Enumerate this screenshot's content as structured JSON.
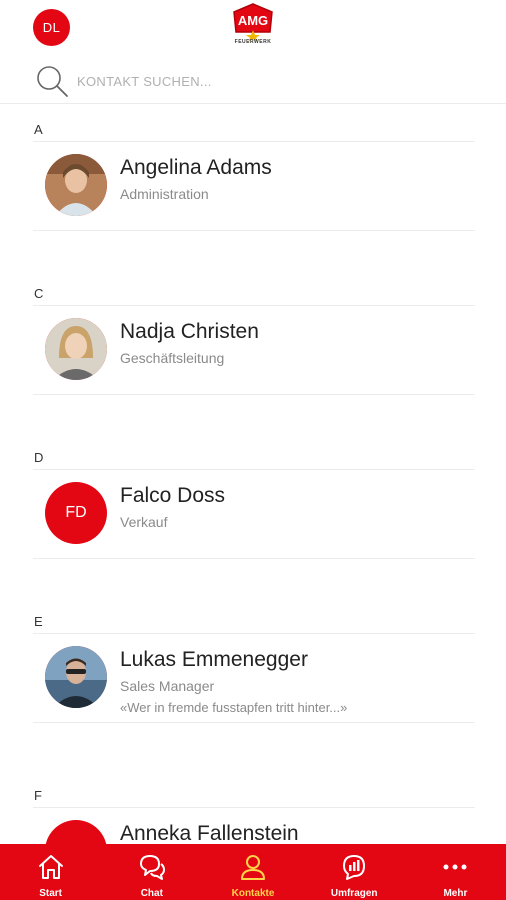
{
  "header": {
    "user_initials": "DL",
    "logo_text": "AMG",
    "logo_subtitle": "FEUERWERK"
  },
  "search": {
    "placeholder": "KONTAKT SUCHEN..."
  },
  "sections": [
    {
      "letter": "A",
      "contacts": [
        {
          "name": "Angelina Adams",
          "role": "Administration",
          "status": "",
          "initials": ""
        }
      ]
    },
    {
      "letter": "C",
      "contacts": [
        {
          "name": "Nadja Christen",
          "role": "Geschäftsleitung",
          "status": "",
          "initials": ""
        }
      ]
    },
    {
      "letter": "D",
      "contacts": [
        {
          "name": "Falco Doss",
          "role": "Verkauf",
          "status": "",
          "initials": "FD"
        }
      ]
    },
    {
      "letter": "E",
      "contacts": [
        {
          "name": "Lukas Emmenegger",
          "role": "Sales Manager",
          "status": "«Wer in fremde fusstapfen tritt hinter...»",
          "initials": ""
        }
      ]
    },
    {
      "letter": "F",
      "contacts": [
        {
          "name": "Anneka Fallenstein",
          "role": "",
          "status": "",
          "initials": ""
        }
      ]
    }
  ],
  "nav": {
    "items": [
      {
        "label": "Start",
        "icon": "home-icon"
      },
      {
        "label": "Chat",
        "icon": "chat-icon"
      },
      {
        "label": "Kontakte",
        "icon": "contacts-icon",
        "active": true
      },
      {
        "label": "Umfragen",
        "icon": "survey-icon"
      },
      {
        "label": "Mehr",
        "icon": "more-icon"
      }
    ],
    "active_color": "#ffd44a",
    "background": "#e30613"
  }
}
